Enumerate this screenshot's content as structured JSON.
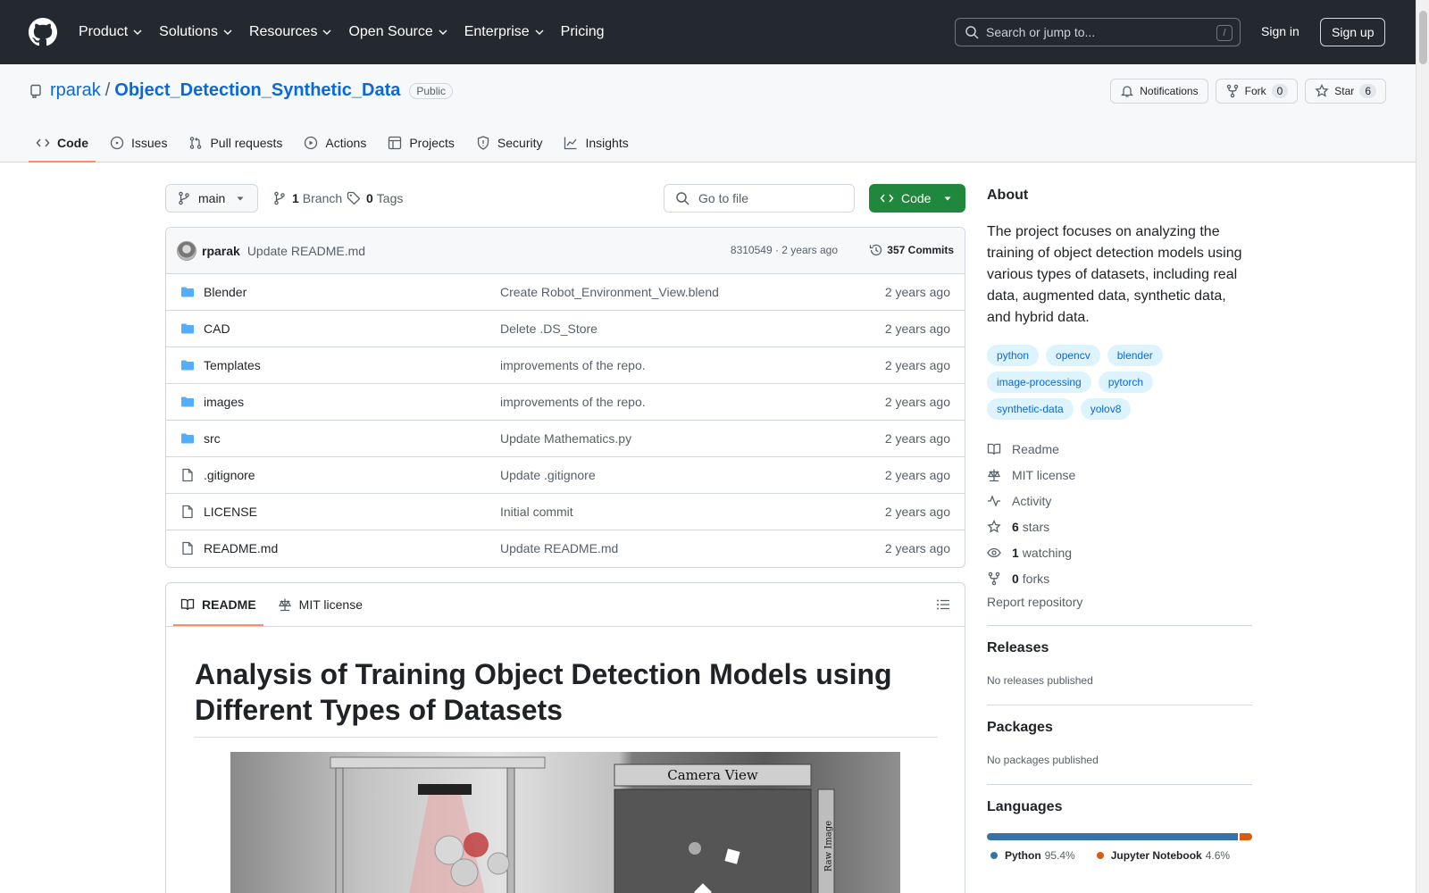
{
  "header": {
    "nav": [
      {
        "label": "Product",
        "has_menu": true
      },
      {
        "label": "Solutions",
        "has_menu": true
      },
      {
        "label": "Resources",
        "has_menu": true
      },
      {
        "label": "Open Source",
        "has_menu": true
      },
      {
        "label": "Enterprise",
        "has_menu": true
      },
      {
        "label": "Pricing",
        "has_menu": false
      }
    ],
    "search_placeholder": "Search or jump to...",
    "search_shortcut": "/",
    "sign_in": "Sign in",
    "sign_up": "Sign up"
  },
  "repo": {
    "owner": "rparak",
    "separator": "/",
    "name": "Object_Detection_Synthetic_Data",
    "visibility": "Public",
    "notifications_label": "Notifications",
    "fork_label": "Fork",
    "fork_count": "0",
    "star_label": "Star",
    "star_count": "6",
    "tabs": [
      {
        "label": "Code",
        "icon": "code-icon",
        "active": true
      },
      {
        "label": "Issues",
        "icon": "issue-icon",
        "active": false
      },
      {
        "label": "Pull requests",
        "icon": "pull-request-icon",
        "active": false
      },
      {
        "label": "Actions",
        "icon": "play-icon",
        "active": false
      },
      {
        "label": "Projects",
        "icon": "table-icon",
        "active": false
      },
      {
        "label": "Security",
        "icon": "shield-icon",
        "active": false
      },
      {
        "label": "Insights",
        "icon": "graph-icon",
        "active": false
      }
    ]
  },
  "toolbar": {
    "branch": "main",
    "branch_count": "1",
    "branch_label": "Branch",
    "tag_count": "0",
    "tag_label": "Tags",
    "goto_placeholder": "Go to file",
    "code_label": "Code"
  },
  "latest_commit": {
    "author": "rparak",
    "message": "Update README.md",
    "meta": "8310549 · 2 years ago",
    "commits": "357 Commits"
  },
  "files": [
    {
      "type": "folder",
      "name": "Blender",
      "message": "Create Robot_Environment_View.blend",
      "age": "2 years ago"
    },
    {
      "type": "folder",
      "name": "CAD",
      "message": "Delete .DS_Store",
      "age": "2 years ago"
    },
    {
      "type": "folder",
      "name": "Templates",
      "message": "improvements of the repo.",
      "age": "2 years ago"
    },
    {
      "type": "folder",
      "name": "images",
      "message": "improvements of the repo.",
      "age": "2 years ago"
    },
    {
      "type": "folder",
      "name": "src",
      "message": "Update Mathematics.py",
      "age": "2 years ago"
    },
    {
      "type": "file",
      "name": ".gitignore",
      "message": "Update .gitignore",
      "age": "2 years ago"
    },
    {
      "type": "file",
      "name": "LICENSE",
      "message": "Initial commit",
      "age": "2 years ago"
    },
    {
      "type": "file",
      "name": "README.md",
      "message": "Update README.md",
      "age": "2 years ago"
    }
  ],
  "readme": {
    "tab_readme": "README",
    "tab_license": "MIT license",
    "title": "Analysis of Training Object Detection Models using Different Types of Datasets",
    "image_camera_label": "Camera View",
    "image_side_label": "Raw Image"
  },
  "about": {
    "heading": "About",
    "description": "The project focuses on analyzing the training of object detection models using various types of datasets, including real data, augmented data, synthetic data, and hybrid data.",
    "topics": [
      "python",
      "opencv",
      "blender",
      "image-processing",
      "pytorch",
      "synthetic-data",
      "yolov8"
    ],
    "links": {
      "readme": "Readme",
      "license": "MIT license",
      "activity": "Activity",
      "stars_count": "6",
      "stars_label": "stars",
      "watching_count": "1",
      "watching_label": "watching",
      "forks_count": "0",
      "forks_label": "forks"
    },
    "report": "Report repository"
  },
  "releases": {
    "heading": "Releases",
    "text": "No releases published"
  },
  "packages": {
    "heading": "Packages",
    "text": "No packages published"
  },
  "languages": {
    "heading": "Languages",
    "items": [
      {
        "name": "Python",
        "percent": "95.4%",
        "fraction": 0.954,
        "color": "#3572A5"
      },
      {
        "name": "Jupyter Notebook",
        "percent": "4.6%",
        "fraction": 0.046,
        "color": "#DA5B0B"
      }
    ]
  }
}
